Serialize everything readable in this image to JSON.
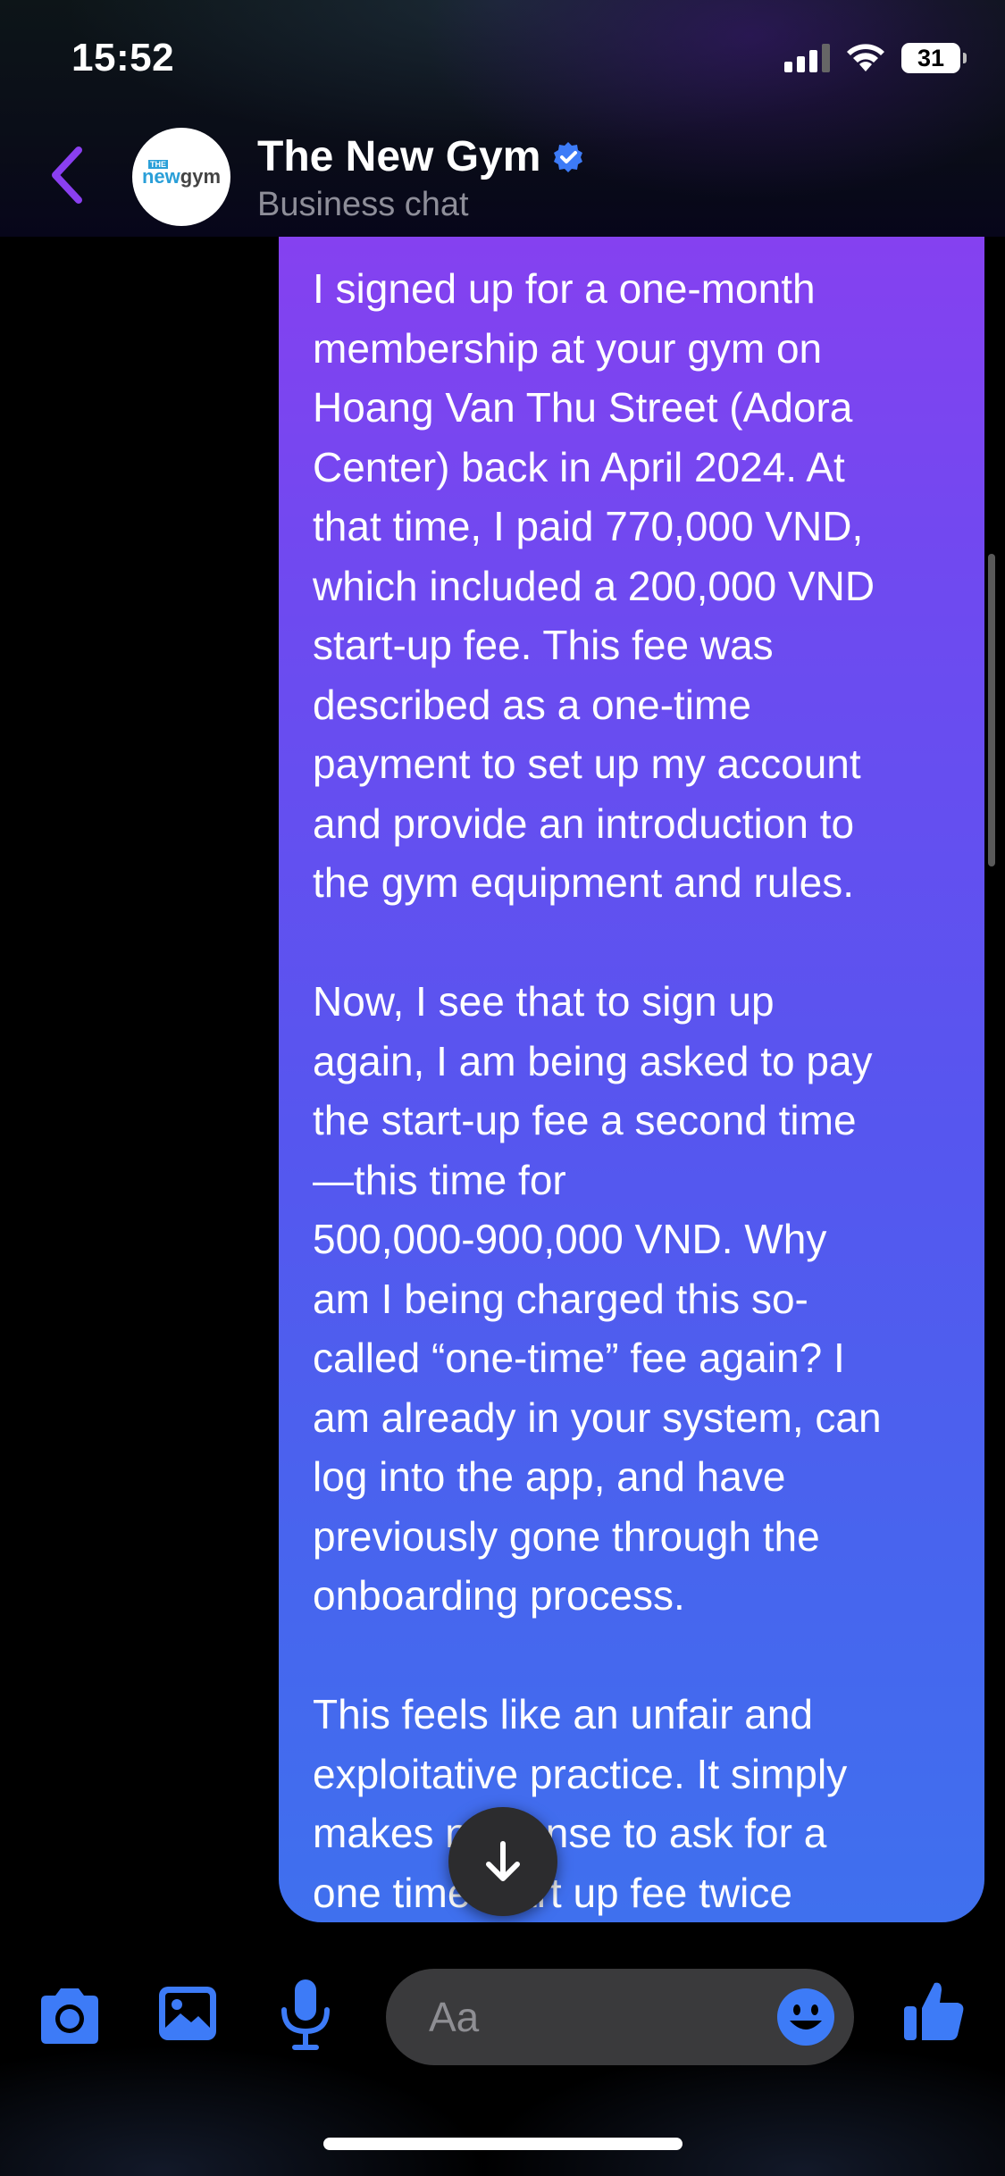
{
  "status_bar": {
    "time": "15:52",
    "battery": "31"
  },
  "header": {
    "title": "The New Gym",
    "subtitle": "Business chat",
    "avatar_logo_small": "THE",
    "avatar_logo_main": "new",
    "avatar_logo_accent": "gym"
  },
  "message": {
    "text": "I signed up for a one-month\nmembership at your gym on\nHoang Van Thu Street (Adora\nCenter) back in April 2024. At\nthat time, I paid 770,000 VND,\nwhich included a 200,000 VND\nstart-up fee. This fee was\ndescribed as a one-time\npayment to set up my account\nand provide an introduction to\nthe gym equipment and rules.\n\nNow, I see that to sign up\nagain, I am being asked to pay\nthe start-up fee a second time\n—this time for\n500,000-900,000 VND. Why\nam I being charged this so-\ncalled “one-time” fee again? I\nam already in your system, can\nlog into the app, and have\npreviously gone through the\nonboarding process.\n\nThis feels like an unfair and\nexploitative practice. It simply\nmakes no sense to ask for a\none time start up fee twice"
  },
  "composer": {
    "placeholder": "Aa"
  },
  "icons": {
    "back": "chevron-left-icon",
    "verified": "verified-badge-icon",
    "scroll_down": "arrow-down-icon",
    "camera": "camera-icon",
    "gallery": "image-icon",
    "mic": "microphone-icon",
    "emoji": "smiley-icon",
    "like": "thumbs-up-icon"
  },
  "colors": {
    "accent": "#3d7bf7",
    "back_arrow": "#8a3ff0",
    "bubble_top": "#8a3ff0",
    "bubble_bottom": "#3f70ee"
  }
}
